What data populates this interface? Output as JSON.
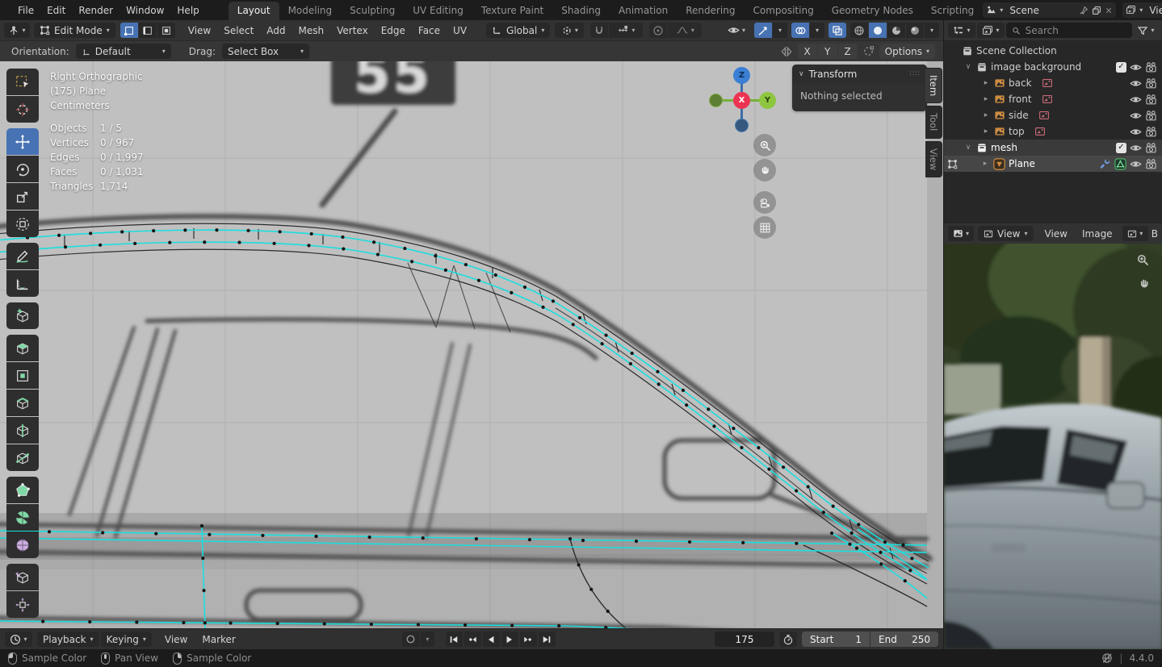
{
  "topbar": {
    "menus": [
      "File",
      "Edit",
      "Render",
      "Window",
      "Help"
    ],
    "tabs": [
      "Layout",
      "Modeling",
      "Sculpting",
      "UV Editing",
      "Texture Paint",
      "Shading",
      "Animation",
      "Rendering",
      "Compositing",
      "Geometry Nodes",
      "Scripting"
    ],
    "active_tab": "Layout",
    "scene_label": "Scene",
    "viewlayer_label": "ViewLayer"
  },
  "viewport_header": {
    "mode_label": "Edit Mode",
    "menus": [
      "View",
      "Select",
      "Add",
      "Mesh",
      "Vertex",
      "Edge",
      "Face",
      "UV"
    ],
    "orientation_label": "Global"
  },
  "tool_settings": {
    "orientation_label": "Orientation:",
    "orientation_value": "Default",
    "drag_label": "Drag:",
    "drag_value": "Select Box",
    "axes": [
      "X",
      "Y",
      "Z"
    ],
    "options_label": "Options"
  },
  "viewport": {
    "view_label": "Right Orthographic",
    "frame_label": "(175) Plane",
    "units_label": "Centimeters",
    "stats": [
      {
        "label": "Objects",
        "value": "1 / 5"
      },
      {
        "label": "Vertices",
        "value": "0 / 967"
      },
      {
        "label": "Edges",
        "value": "0 / 1,997"
      },
      {
        "label": "Faces",
        "value": "0 / 1,031"
      },
      {
        "label": "Triangles",
        "value": "1,714"
      }
    ],
    "gizmo_axes": {
      "x": "X",
      "y": "Y",
      "z": "Z"
    },
    "sidebar_tabs": [
      "Item",
      "Tool",
      "View"
    ],
    "active_sidebar_tab": "Item",
    "transform_panel": {
      "title": "Transform",
      "message": "Nothing selected"
    },
    "background_sign_text": "55"
  },
  "outliner": {
    "search_placeholder": "Search",
    "items": [
      {
        "label": "Scene Collection"
      },
      {
        "label": "image background"
      },
      {
        "label": "back"
      },
      {
        "label": "front"
      },
      {
        "label": "side"
      },
      {
        "label": "top"
      },
      {
        "label": "mesh"
      },
      {
        "label": "Plane"
      }
    ]
  },
  "image_editor": {
    "display_mode": "View",
    "menus": [
      "View",
      "Image"
    ],
    "image_name": "B"
  },
  "timeline": {
    "playback_label": "Playback",
    "keying_label": "Keying",
    "menus": [
      "View",
      "Marker"
    ],
    "current_frame": "175",
    "start_label": "Start",
    "start_value": "1",
    "end_label": "End",
    "end_value": "250"
  },
  "statusbar": {
    "hints": [
      {
        "label": "Sample Color"
      },
      {
        "label": "Pan View"
      },
      {
        "label": "Sample Color"
      }
    ],
    "version": "4.4.0"
  },
  "colors": {
    "accent_blue": "#4772b3",
    "select_cyan": "#1bdede",
    "viewport_bg": "#b3b3b3",
    "header_bg": "#323232",
    "dark_bg": "#1d1d1d"
  }
}
